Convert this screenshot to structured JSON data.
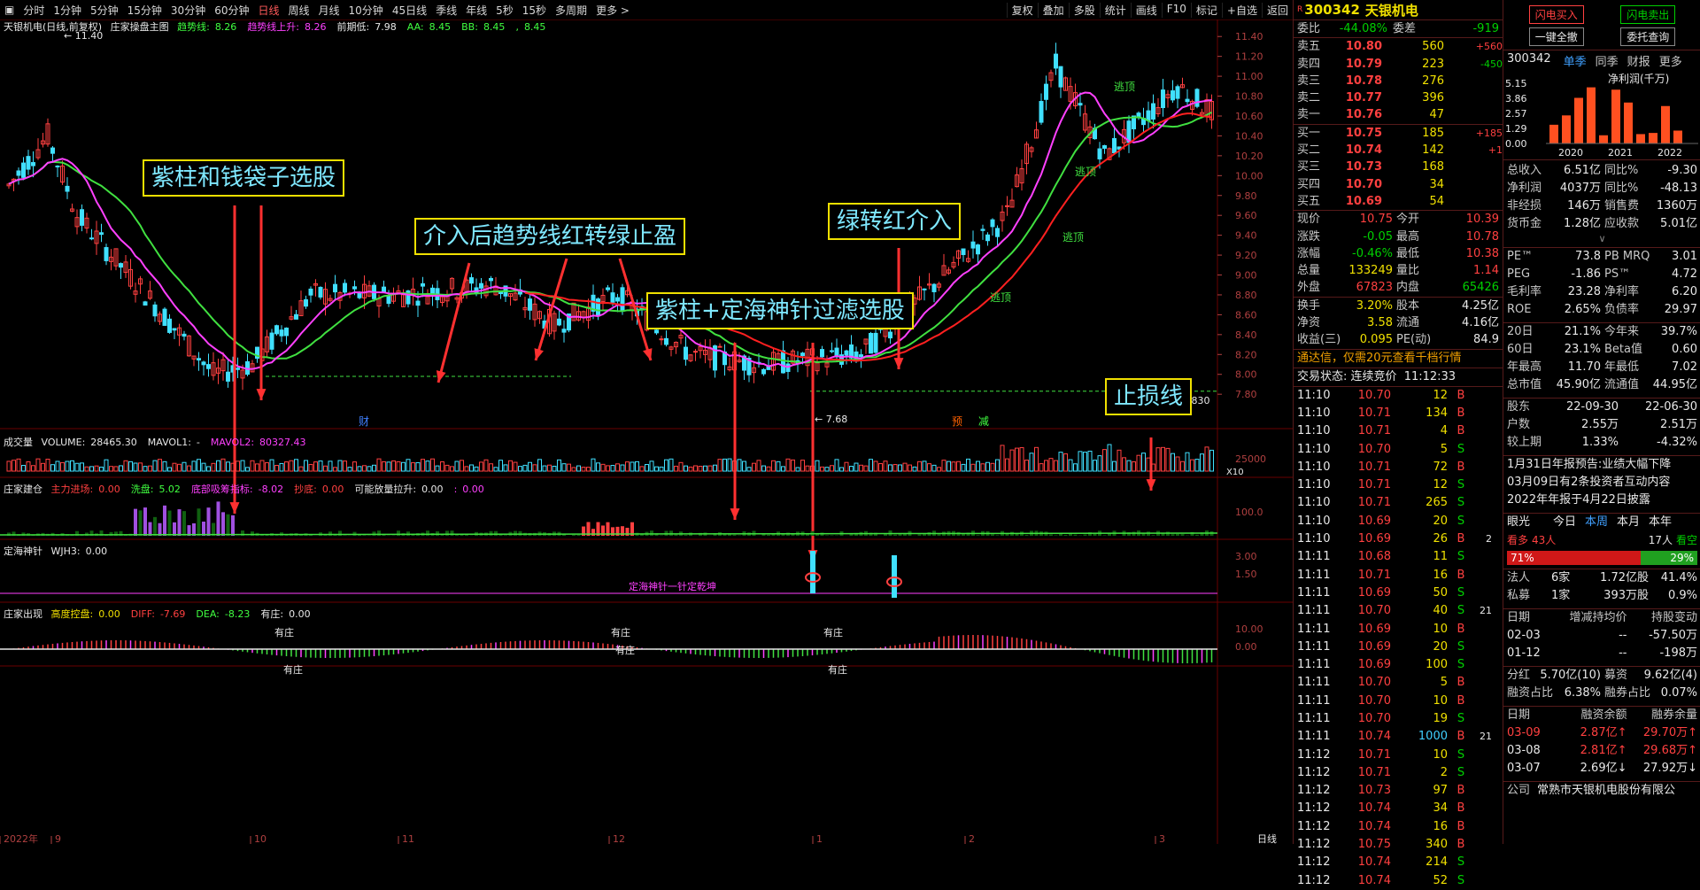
{
  "toolbar": {
    "periods": [
      "分时",
      "1分钟",
      "5分钟",
      "15分钟",
      "30分钟",
      "60分钟",
      "日线",
      "周线",
      "月线",
      "10分钟",
      "45日线",
      "季线",
      "年线",
      "5秒",
      "15秒",
      "多周期",
      "更多 >"
    ],
    "active_period": "日线",
    "right_buttons": [
      "复权",
      "叠加",
      "多股",
      "统计",
      "画线",
      "F10",
      "标记",
      "+自选",
      "返回"
    ]
  },
  "main_panel": {
    "stock_title": "天银机电(日线,前复权)",
    "indicator_name": "庄家操盘主图",
    "indicators": [
      {
        "label": "趋势线:",
        "value": "8.26",
        "color": "#40ff40"
      },
      {
        "label": "趋势线上升:",
        "value": "8.26",
        "color": "#ff40ff"
      },
      {
        "label": "前期低:",
        "value": "7.98",
        "color": "#e8e8e8"
      },
      {
        "label": "AA:",
        "value": "8.45",
        "color": "#40ff40"
      },
      {
        "label": "BB:",
        "value": "8.45",
        "color": "#40ff40"
      },
      {
        "label": ",",
        "value": "8.45",
        "color": "#40ff40"
      }
    ],
    "high_label": "11.40",
    "low_label": "7.68",
    "price_right_label": "7.830",
    "axis_ticks": [
      "11.40",
      "11.20",
      "11.00",
      "10.80",
      "10.60",
      "10.40",
      "10.20",
      "10.00",
      "9.80",
      "9.60",
      "9.40",
      "9.20",
      "9.00",
      "8.80",
      "8.60",
      "8.40",
      "8.20",
      "8.00",
      "7.80"
    ],
    "markers": [
      {
        "text": "财",
        "color": "#4080ff"
      },
      {
        "text": "预",
        "color": "#ff6000"
      },
      {
        "text": "减",
        "color": "#40ff40"
      }
    ],
    "top_signals": [
      "逃顶",
      "逃顶",
      "逃顶",
      "逃顶"
    ]
  },
  "callouts": [
    "紫柱和钱袋子选股",
    "介入后趋势线红转绿止盈",
    "紫柱+定海神针过滤选股",
    "绿转红介入",
    "止损线"
  ],
  "volume_panel": {
    "title": "成交量",
    "items": [
      {
        "label": "VOLUME:",
        "value": "28465.30",
        "color": "#e8e8e8"
      },
      {
        "label": "MAVOL1:",
        "value": "-",
        "color": "#e8e8e8"
      },
      {
        "label": "MAVOL2:",
        "value": "80327.43",
        "color": "#ff40ff"
      }
    ],
    "axis": "25000",
    "unit": "X10"
  },
  "zhuangjia_panel": {
    "title": "庄家建仓",
    "items": [
      {
        "label": "主力进场:",
        "value": "0.00",
        "color": "#ff4040"
      },
      {
        "label": "洗盘:",
        "value": "5.02",
        "color": "#40ff40"
      },
      {
        "label": "底部吸筹指标:",
        "value": "-8.02",
        "color": "#ff40ff"
      },
      {
        "label": "抄底:",
        "value": "0.00",
        "color": "#ff4040"
      },
      {
        "label": "可能放量拉升:",
        "value": "0.00",
        "color": "#e8e8e8"
      },
      {
        "label": ":",
        "value": "0.00",
        "color": "#ff40ff"
      }
    ],
    "axis": "100.0"
  },
  "dinghai_panel": {
    "title": "定海神针",
    "items": [
      {
        "label": "WJH3:",
        "value": "0.00",
        "color": "#e8e8e8"
      }
    ],
    "axis": [
      "3.00",
      "1.50"
    ],
    "note": "定海神针一针定乾坤"
  },
  "chuxian_panel": {
    "title": "庄家出现",
    "items": [
      {
        "label": "高度控盘:",
        "value": "0.00",
        "color": "#f0e000"
      },
      {
        "label": "DIFF:",
        "value": "-7.69",
        "color": "#ff4040"
      },
      {
        "label": "DEA:",
        "value": "-8.23",
        "color": "#40ff40"
      },
      {
        "label": "有庄:",
        "value": "0.00",
        "color": "#e8e8e8"
      }
    ],
    "axis": [
      "10.00",
      "0.00"
    ],
    "tags": [
      "有庄",
      "有庄",
      "有庄",
      "有庄",
      "有庄",
      "有庄"
    ]
  },
  "x_axis": [
    "2022年",
    "9",
    "10",
    "11",
    "12",
    "1",
    "2",
    "3"
  ],
  "x_axis_right": "日线",
  "quote": {
    "code": "300342",
    "name": "天银机电",
    "weibi_label": "委比",
    "weibi": "-44.08%",
    "weicha_label": "委差",
    "weicha": "-919",
    "asks": [
      {
        "label": "卖五",
        "price": "10.80",
        "vol": "560",
        "chg": "+560"
      },
      {
        "label": "卖四",
        "price": "10.79",
        "vol": "223",
        "chg": "-450"
      },
      {
        "label": "卖三",
        "price": "10.78",
        "vol": "276",
        "chg": ""
      },
      {
        "label": "卖二",
        "price": "10.77",
        "vol": "396",
        "chg": ""
      },
      {
        "label": "卖一",
        "price": "10.76",
        "vol": "47",
        "chg": ""
      }
    ],
    "bids": [
      {
        "label": "买一",
        "price": "10.75",
        "vol": "185",
        "chg": "+185"
      },
      {
        "label": "买二",
        "price": "10.74",
        "vol": "142",
        "chg": "+1"
      },
      {
        "label": "买三",
        "price": "10.73",
        "vol": "168",
        "chg": ""
      },
      {
        "label": "买四",
        "price": "10.70",
        "vol": "34",
        "chg": ""
      },
      {
        "label": "买五",
        "price": "10.69",
        "vol": "54",
        "chg": ""
      }
    ],
    "stats": [
      {
        "l1": "现价",
        "v1": "10.75",
        "c1": "red",
        "l2": "今开",
        "v2": "10.39",
        "c2": "red"
      },
      {
        "l1": "涨跌",
        "v1": "-0.05",
        "c1": "grn",
        "l2": "最高",
        "v2": "10.78",
        "c2": "red"
      },
      {
        "l1": "涨幅",
        "v1": "-0.46%",
        "c1": "grn",
        "l2": "最低",
        "v2": "10.38",
        "c2": "red"
      },
      {
        "l1": "总量",
        "v1": "133249",
        "c1": "yel",
        "l2": "量比",
        "v2": "1.14",
        "c2": "red"
      },
      {
        "l1": "外盘",
        "v1": "67823",
        "c1": "red",
        "l2": "内盘",
        "v2": "65426",
        "c2": "grn"
      }
    ],
    "stats2": [
      {
        "l1": "换手",
        "v1": "3.20%",
        "l2": "股本",
        "v2": "4.25亿"
      },
      {
        "l1": "净资",
        "v1": "3.58",
        "l2": "流通",
        "v2": "4.16亿"
      },
      {
        "l1": "收益(三)",
        "v1": "0.095",
        "l2": "PE(动)",
        "v2": "84.9"
      }
    ],
    "promo": "通达信，仅需20元查看千档行情",
    "trade_state_label": "交易状态:",
    "trade_state": "连续竞价",
    "trade_time": "11:12:33",
    "ticks": [
      [
        "11:10",
        "10.70",
        "12",
        "B"
      ],
      [
        "11:10",
        "10.71",
        "134",
        "B"
      ],
      [
        "11:10",
        "10.71",
        "4",
        "B"
      ],
      [
        "11:10",
        "10.70",
        "5",
        "S"
      ],
      [
        "11:10",
        "10.71",
        "72",
        "B"
      ],
      [
        "11:10",
        "10.71",
        "12",
        "S"
      ],
      [
        "11:10",
        "10.71",
        "265",
        "S"
      ],
      [
        "11:10",
        "10.69",
        "20",
        "S"
      ],
      [
        "11:10",
        "10.69",
        "26",
        "B"
      ],
      [
        "11:11",
        "10.68",
        "11",
        "S"
      ],
      [
        "11:11",
        "10.71",
        "16",
        "B"
      ],
      [
        "11:11",
        "10.69",
        "50",
        "S"
      ],
      [
        "11:11",
        "10.70",
        "40",
        "S"
      ],
      [
        "11:11",
        "10.69",
        "10",
        "B"
      ],
      [
        "11:11",
        "10.69",
        "20",
        "S"
      ],
      [
        "11:11",
        "10.69",
        "100",
        "S"
      ],
      [
        "11:11",
        "10.70",
        "5",
        "B"
      ],
      [
        "11:11",
        "10.70",
        "10",
        "B"
      ],
      [
        "11:11",
        "10.70",
        "19",
        "S"
      ],
      [
        "11:11",
        "10.74",
        "1000",
        "B"
      ],
      [
        "11:12",
        "10.71",
        "10",
        "S"
      ],
      [
        "11:12",
        "10.71",
        "2",
        "S"
      ],
      [
        "11:12",
        "10.73",
        "97",
        "B"
      ],
      [
        "11:12",
        "10.74",
        "34",
        "B"
      ],
      [
        "11:12",
        "10.74",
        "16",
        "B"
      ],
      [
        "11:12",
        "10.75",
        "340",
        "B"
      ],
      [
        "11:12",
        "10.74",
        "214",
        "S"
      ],
      [
        "11:12",
        "10.74",
        "52",
        "S"
      ]
    ],
    "tick_suffix": [
      "",
      "",
      "",
      "",
      "",
      "",
      "",
      "",
      "2",
      "",
      "",
      "",
      "21",
      "",
      "",
      "",
      "",
      "",
      "",
      "21",
      "",
      "",
      "",
      "",
      "",
      "",
      "",
      ""
    ]
  },
  "f10": {
    "buttons": [
      "闪电买入",
      "闪电卖出",
      "一键全撤",
      "委托查询"
    ],
    "code": "300342",
    "tabs": [
      "单季",
      "同季",
      "财报",
      "更多"
    ],
    "chart_label": "净利润(千万)",
    "chart_axis": [
      "5.15",
      "3.86",
      "2.57",
      "1.29",
      "0.00"
    ],
    "chart_years": [
      "2020",
      "2021",
      "2022"
    ],
    "fin": [
      {
        "l1": "总收入",
        "v1": "6.51亿",
        "l2": "同比%",
        "v2": "-9.30"
      },
      {
        "l1": "净利润",
        "v1": "4037万",
        "l2": "同比%",
        "v2": "-48.13"
      },
      {
        "l1": "非经损",
        "v1": "146万",
        "l2": "销售费",
        "v2": "1360万"
      },
      {
        "l1": "货币金",
        "v1": "1.28亿",
        "l2": "应收款",
        "v2": "5.01亿"
      }
    ],
    "val": [
      {
        "l1": "PE™",
        "v1": "73.8",
        "l2": "PB MRQ",
        "v2": "3.01"
      },
      {
        "l1": "PEG",
        "v1": "-1.86",
        "l2": "PS™",
        "v2": "4.72"
      },
      {
        "l1": "毛利率",
        "v1": "23.28",
        "l2": "净利率",
        "v2": "6.20"
      },
      {
        "l1": "ROE",
        "v1": "2.65%",
        "l2": "负债率",
        "v2": "29.97"
      }
    ],
    "perf": [
      {
        "l1": "20日",
        "v1": "21.1%",
        "l2": "今年来",
        "v2": "39.7%"
      },
      {
        "l1": "60日",
        "v1": "23.1%",
        "l2": "Beta值",
        "v2": "0.60"
      },
      {
        "l1": "年最高",
        "v1": "11.70",
        "l2": "年最低",
        "v2": "7.02"
      },
      {
        "l1": "总市值",
        "v1": "45.90亿",
        "l2": "流通值",
        "v2": "44.95亿"
      }
    ],
    "holders": [
      {
        "l1": "股东",
        "v1": "22-09-30",
        "v2": "22-06-30"
      },
      {
        "l1": "户数",
        "v1": "2.55万",
        "v2": "2.51万"
      },
      {
        "l1": "较上期",
        "v1": "1.33%",
        "v2": "-4.32%"
      }
    ],
    "news": [
      "1月31日年报预告:业绩大幅下降",
      "03月09日有2条投资者互动内容",
      "2022年年报于4月22日披露"
    ],
    "eye": {
      "label": "眼光",
      "tabs": [
        "今日",
        "本周",
        "本月",
        "本年"
      ],
      "bull": "看多",
      "bull_count": "43人",
      "bear_count": "17人",
      "bear": "看空",
      "bull_pct": "71%",
      "bear_pct": "29%"
    },
    "inst": [
      {
        "l": "法人",
        "c": "6家",
        "v": "1.72亿股",
        "p": "41.4%"
      },
      {
        "l": "私募",
        "c": "1家",
        "v": "393万股",
        "p": "0.9%"
      }
    ],
    "change_head": [
      "日期",
      "增减持均价",
      "持股变动"
    ],
    "changes": [
      {
        "d": "02-03",
        "a": "--",
        "b": "-57.50万"
      },
      {
        "d": "01-12",
        "a": "--",
        "b": "-198万"
      }
    ],
    "dividend": {
      "l": "分红",
      "v": "5.70亿(10)",
      "l2": "募资",
      "v2": "9.62亿(4)"
    },
    "margin_ratio": {
      "l": "融资占比",
      "v": "6.38%",
      "l2": "融券占比",
      "v2": "0.07%"
    },
    "margin_head": [
      "日期",
      "融资余额",
      "融券余量"
    ],
    "margins": [
      {
        "d": "03-09",
        "a": "2.87亿↑",
        "b": "29.70万↑"
      },
      {
        "d": "03-08",
        "a": "2.81亿↑",
        "b": "29.68万↑"
      },
      {
        "d": "03-07",
        "a": "2.69亿↓",
        "b": "27.92万↓"
      }
    ],
    "company_label": "公司",
    "company": "常熟市天银机电股份有限公"
  }
}
